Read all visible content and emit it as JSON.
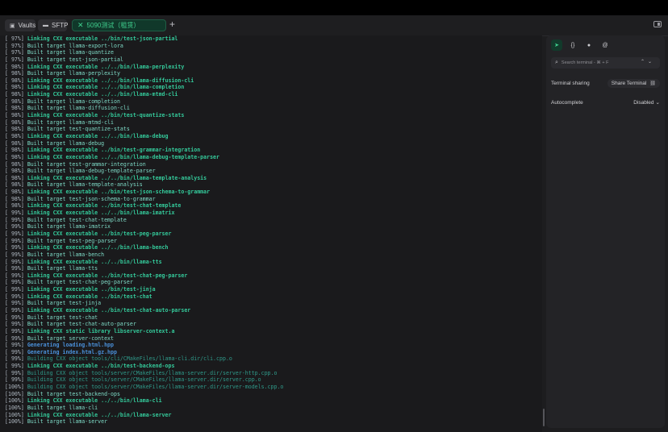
{
  "tabs": [
    {
      "label": "Vaults",
      "icon": "vault-icon",
      "active": false
    },
    {
      "label": "SFTP",
      "icon": "folder-icon",
      "active": false
    },
    {
      "label": "5090测试（租赁）",
      "icon": "close-icon",
      "active": true
    }
  ],
  "new_tab_label": "+",
  "sidebar": {
    "search_placeholder": "Search terminal - ⌘ + F",
    "terminal_sharing_label": "Terminal sharing",
    "share_button_label": "Share Terminal",
    "autocomplete_label": "Autocomplete",
    "autocomplete_value": "Disabled"
  },
  "terminal_lines": [
    {
      "pct": "[ 97%]",
      "msg": "Linking CXX executable ../bin/test-json-partial",
      "type": "link"
    },
    {
      "pct": "[ 97%]",
      "msg": "Built target llama-export-lora",
      "type": "build"
    },
    {
      "pct": "[ 97%]",
      "msg": "Built target llama-quantize",
      "type": "build"
    },
    {
      "pct": "[ 97%]",
      "msg": "Built target test-json-partial",
      "type": "build"
    },
    {
      "pct": "[ 98%]",
      "msg": "Linking CXX executable ../../bin/llama-perplexity",
      "type": "link"
    },
    {
      "pct": "[ 98%]",
      "msg": "Built target llama-perplexity",
      "type": "build"
    },
    {
      "pct": "[ 98%]",
      "msg": "Linking CXX executable ../../bin/llama-diffusion-cli",
      "type": "link"
    },
    {
      "pct": "[ 98%]",
      "msg": "Linking CXX executable ../../bin/llama-completion",
      "type": "link"
    },
    {
      "pct": "[ 98%]",
      "msg": "Linking CXX executable ../../bin/llama-mtmd-cli",
      "type": "link"
    },
    {
      "pct": "[ 98%]",
      "msg": "Built target llama-completion",
      "type": "build"
    },
    {
      "pct": "[ 98%]",
      "msg": "Built target llama-diffusion-cli",
      "type": "build"
    },
    {
      "pct": "[ 98%]",
      "msg": "Linking CXX executable ../bin/test-quantize-stats",
      "type": "link"
    },
    {
      "pct": "[ 98%]",
      "msg": "Built target llama-mtmd-cli",
      "type": "build"
    },
    {
      "pct": "[ 98%]",
      "msg": "Built target test-quantize-stats",
      "type": "build"
    },
    {
      "pct": "[ 98%]",
      "msg": "Linking CXX executable ../../bin/llama-debug",
      "type": "link"
    },
    {
      "pct": "[ 98%]",
      "msg": "Built target llama-debug",
      "type": "build"
    },
    {
      "pct": "[ 98%]",
      "msg": "Linking CXX executable ../bin/test-grammar-integration",
      "type": "link"
    },
    {
      "pct": "[ 98%]",
      "msg": "Linking CXX executable ../../bin/llama-debug-template-parser",
      "type": "link"
    },
    {
      "pct": "[ 98%]",
      "msg": "Built target test-grammar-integration",
      "type": "build"
    },
    {
      "pct": "[ 98%]",
      "msg": "Built target llama-debug-template-parser",
      "type": "build"
    },
    {
      "pct": "[ 98%]",
      "msg": "Linking CXX executable ../../bin/llama-template-analysis",
      "type": "link"
    },
    {
      "pct": "[ 98%]",
      "msg": "Built target llama-template-analysis",
      "type": "build"
    },
    {
      "pct": "[ 98%]",
      "msg": "Linking CXX executable ../bin/test-json-schema-to-grammar",
      "type": "link"
    },
    {
      "pct": "[ 98%]",
      "msg": "Built target test-json-schema-to-grammar",
      "type": "build"
    },
    {
      "pct": "[ 98%]",
      "msg": "Linking CXX executable ../bin/test-chat-template",
      "type": "link"
    },
    {
      "pct": "[ 99%]",
      "msg": "Linking CXX executable ../../bin/llama-imatrix",
      "type": "link"
    },
    {
      "pct": "[ 99%]",
      "msg": "Built target test-chat-template",
      "type": "build"
    },
    {
      "pct": "[ 99%]",
      "msg": "Built target llama-imatrix",
      "type": "build"
    },
    {
      "pct": "[ 99%]",
      "msg": "Linking CXX executable ../bin/test-peg-parser",
      "type": "link"
    },
    {
      "pct": "[ 99%]",
      "msg": "Built target test-peg-parser",
      "type": "build"
    },
    {
      "pct": "[ 99%]",
      "msg": "Linking CXX executable ../../bin/llama-bench",
      "type": "link"
    },
    {
      "pct": "[ 99%]",
      "msg": "Built target llama-bench",
      "type": "build"
    },
    {
      "pct": "[ 99%]",
      "msg": "Linking CXX executable ../../bin/llama-tts",
      "type": "link"
    },
    {
      "pct": "[ 99%]",
      "msg": "Built target llama-tts",
      "type": "build"
    },
    {
      "pct": "[ 99%]",
      "msg": "Linking CXX executable ../bin/test-chat-peg-parser",
      "type": "link"
    },
    {
      "pct": "[ 99%]",
      "msg": "Built target test-chat-peg-parser",
      "type": "build"
    },
    {
      "pct": "[ 99%]",
      "msg": "Linking CXX executable ../bin/test-jinja",
      "type": "link"
    },
    {
      "pct": "[ 99%]",
      "msg": "Linking CXX executable ../bin/test-chat",
      "type": "link"
    },
    {
      "pct": "[ 99%]",
      "msg": "Built target test-jinja",
      "type": "build"
    },
    {
      "pct": "[ 99%]",
      "msg": "Linking CXX executable ../bin/test-chat-auto-parser",
      "type": "link"
    },
    {
      "pct": "[ 99%]",
      "msg": "Built target test-chat",
      "type": "build"
    },
    {
      "pct": "[ 99%]",
      "msg": "Built target test-chat-auto-parser",
      "type": "build"
    },
    {
      "pct": "[ 99%]",
      "msg": "Linking CXX static library libserver-context.a",
      "type": "lib"
    },
    {
      "pct": "[ 99%]",
      "msg": "Built target server-context",
      "type": "build"
    },
    {
      "pct": "[ 99%]",
      "msg": "Generating loading.html.hpp",
      "type": "gen"
    },
    {
      "pct": "[ 99%]",
      "msg": "Generating index.html.gz.hpp",
      "type": "gen"
    },
    {
      "pct": "[ 99%]",
      "msg": "Building CXX object tools/cli/CMakeFiles/llama-cli.dir/cli.cpp.o",
      "type": "obj"
    },
    {
      "pct": "[ 99%]",
      "msg": "Linking CXX executable ../bin/test-backend-ops",
      "type": "link"
    },
    {
      "pct": "[ 99%]",
      "msg": "Building CXX object tools/server/CMakeFiles/llama-server.dir/server-http.cpp.o",
      "type": "obj"
    },
    {
      "pct": "[ 99%]",
      "msg": "Building CXX object tools/server/CMakeFiles/llama-server.dir/server.cpp.o",
      "type": "obj"
    },
    {
      "pct": "[100%]",
      "msg": "Building CXX object tools/server/CMakeFiles/llama-server.dir/server-models.cpp.o",
      "type": "obj"
    },
    {
      "pct": "[100%]",
      "msg": "Built target test-backend-ops",
      "type": "build"
    },
    {
      "pct": "[100%]",
      "msg": "Linking CXX executable ../../bin/llama-cli",
      "type": "link"
    },
    {
      "pct": "[100%]",
      "msg": "Built target llama-cli",
      "type": "build"
    },
    {
      "pct": "[100%]",
      "msg": "Linking CXX executable ../../bin/llama-server",
      "type": "link"
    },
    {
      "pct": "[100%]",
      "msg": "Built target llama-server",
      "type": "build"
    }
  ]
}
